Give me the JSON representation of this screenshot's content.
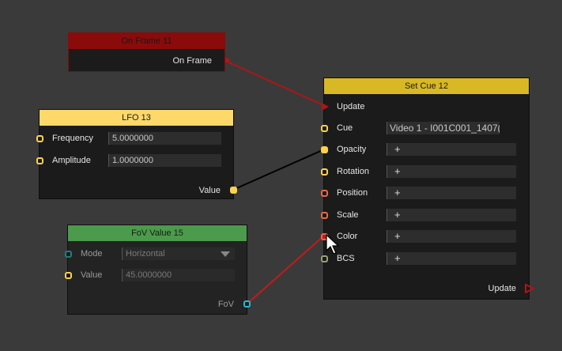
{
  "nodes": {
    "on_frame": {
      "title": "On Frame 11",
      "output_label": "On Frame"
    },
    "lfo": {
      "title": "LFO 13",
      "frequency_label": "Frequency",
      "frequency_value": "5.0000000",
      "amplitude_label": "Amplitude",
      "amplitude_value": "1.0000000",
      "output_label": "Value"
    },
    "fov": {
      "title": "FoV Value 15",
      "mode_label": "Mode",
      "mode_value": "Horizontal",
      "value_label": "Value",
      "value_value": "45.0000000",
      "output_label": "FoV"
    },
    "set_cue": {
      "title": "Set Cue 12",
      "update_in_label": "Update",
      "cue_label": "Cue",
      "cue_value": "Video 1 - I001C001_1407(",
      "opacity_label": "Opacity",
      "rotation_label": "Rotation",
      "position_label": "Position",
      "scale_label": "Scale",
      "color_label": "Color",
      "bcs_label": "BCS",
      "plus": "+",
      "update_out_label": "Update"
    }
  },
  "colors": {
    "background": "#3a3a3a",
    "on_frame_header": "#8b0a0a",
    "lfo_header": "#ffd86a",
    "fov_header": "#4c9a4c",
    "set_cue_header": "#d9b825",
    "port_yellow": "#ffd24d",
    "port_orange": "#e7694a",
    "port_teal": "#1f7f7f",
    "port_cyan": "#28b7d8",
    "wire_red": "#c41a1a",
    "wire_black": "#000000"
  }
}
